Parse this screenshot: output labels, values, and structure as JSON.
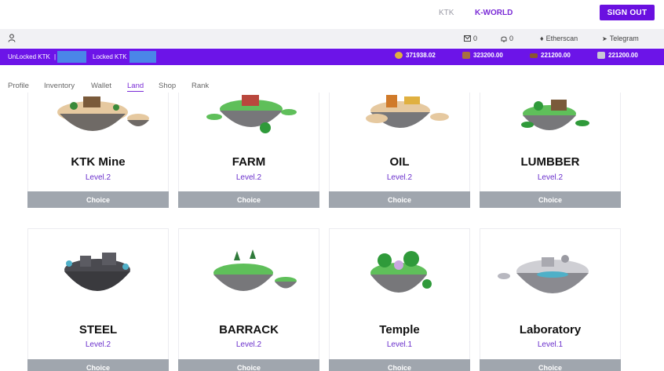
{
  "header": {
    "nav": [
      "KTK",
      "K-WORLD"
    ],
    "sign_out": "SIGN OUT"
  },
  "subbar": {
    "mail_count": "0",
    "bell_count": "0",
    "etherscan": "Etherscan",
    "telegram": "Telegram"
  },
  "ktk_bar": {
    "unlocked_label": "UnLocked KTK",
    "separator": "|",
    "locked_label": "Locked KTK",
    "resources": [
      {
        "icon": "gold-icon",
        "value": "371938.02",
        "color": "#e0b040"
      },
      {
        "icon": "crate-icon",
        "value": "323200.00",
        "color": "#a87040"
      },
      {
        "icon": "lumber-icon",
        "value": "221200.00",
        "color": "#8a5530"
      },
      {
        "icon": "stone-icon",
        "value": "221200.00",
        "color": "#c9c9d4"
      }
    ]
  },
  "tabs": [
    "Profile",
    "Inventory",
    "Wallet",
    "Land",
    "Shop",
    "Rank"
  ],
  "active_tab": "Land",
  "choice_label": "Choice",
  "lands": [
    {
      "name": "KTK Mine",
      "level": "Level.2"
    },
    {
      "name": "FARM",
      "level": "Level.2"
    },
    {
      "name": "OIL",
      "level": "Level.2"
    },
    {
      "name": "LUMBBER",
      "level": "Level.2"
    },
    {
      "name": "STEEL",
      "level": "Level.2"
    },
    {
      "name": "BARRACK",
      "level": "Level.2"
    },
    {
      "name": "Temple",
      "level": "Level.1"
    },
    {
      "name": "Laboratory",
      "level": "Level.1"
    }
  ]
}
